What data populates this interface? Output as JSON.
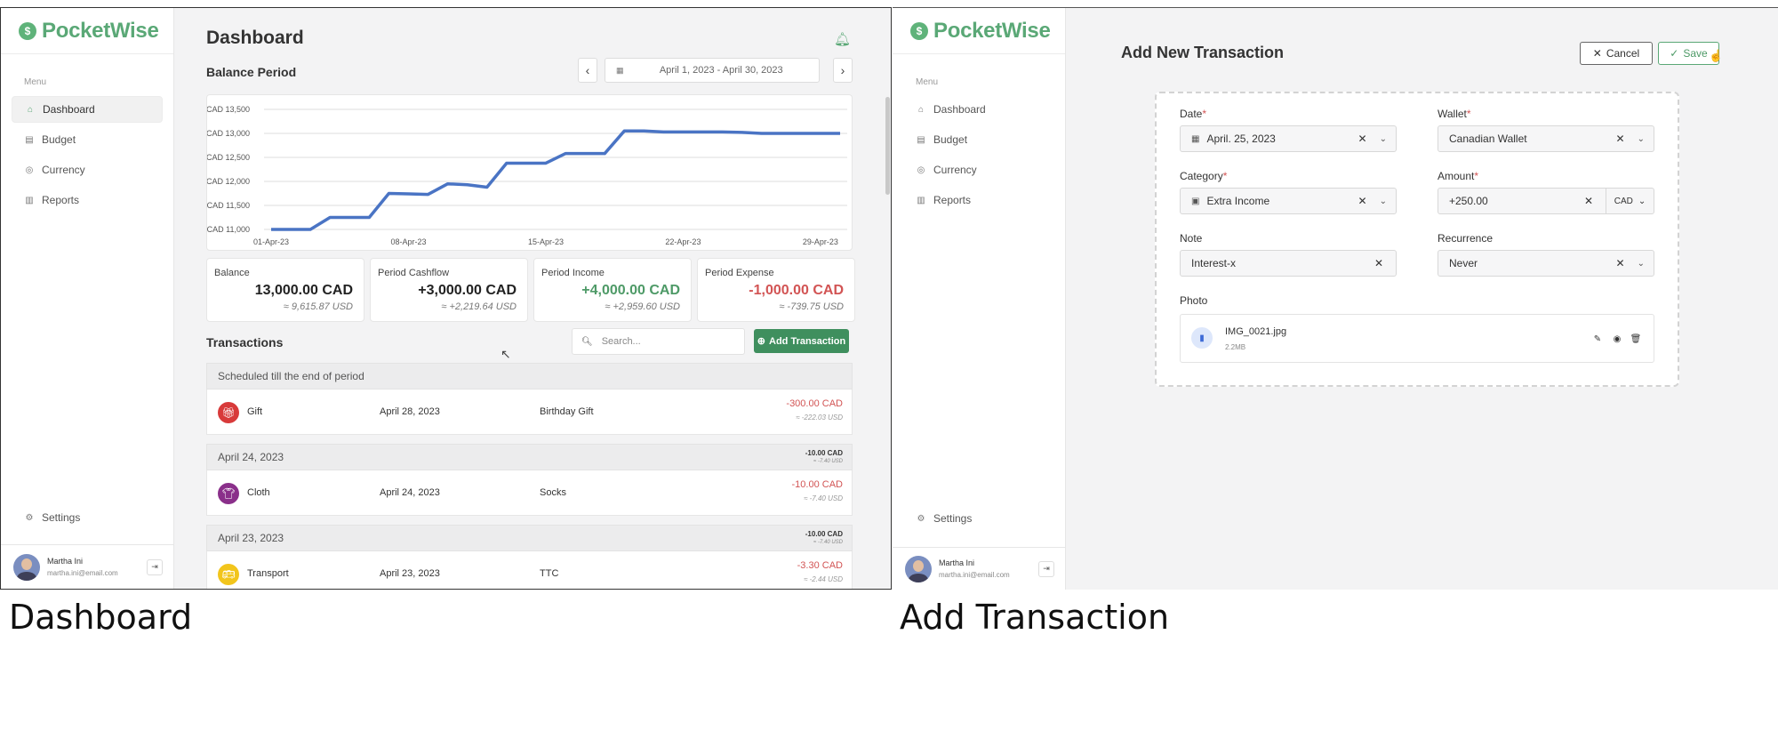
{
  "app_name": "PocketWise",
  "sidebar": {
    "menu_label": "Menu",
    "items": [
      {
        "label": "Dashboard",
        "icon": "home-icon"
      },
      {
        "label": "Budget",
        "icon": "budget-icon"
      },
      {
        "label": "Currency",
        "icon": "currency-icon"
      },
      {
        "label": "Reports",
        "icon": "reports-icon"
      }
    ],
    "settings_label": "Settings",
    "user": {
      "name": "Martha Ini",
      "email": "martha.ini@email.com"
    }
  },
  "dashboard": {
    "title": "Dashboard",
    "balance_period_title": "Balance Period",
    "date_range": "April 1, 2023 - April 30, 2023",
    "cards": [
      {
        "label": "Balance",
        "value": "13,000.00 CAD",
        "sub": "≈ 9,615.87 USD",
        "tone": "neutral"
      },
      {
        "label": "Period Cashflow",
        "value": "+3,000.00 CAD",
        "sub": "≈ +2,219.64 USD",
        "tone": "neutral"
      },
      {
        "label": "Period Income",
        "value": "+4,000.00 CAD",
        "sub": "≈ +2,959.60 USD",
        "tone": "green"
      },
      {
        "label": "Period Expense",
        "value": "-1,000.00 CAD",
        "sub": "≈ -739.75 USD",
        "tone": "red"
      }
    ],
    "transactions_title": "Transactions",
    "search_placeholder": "Search...",
    "add_transaction_label": "Add Transaction",
    "groups": [
      {
        "header": "Scheduled till the end of period",
        "total": "",
        "total_usd": "",
        "rows": [
          {
            "category": "Gift",
            "date": "April 28, 2023",
            "note": "Birthday Gift",
            "amount": "-300.00 CAD",
            "amount_usd": "≈ -222.03 USD",
            "color": "#d83a3a",
            "icon": "gift-icon"
          }
        ]
      },
      {
        "header": "April 24, 2023",
        "total": "-10.00 CAD",
        "total_usd": "≈ -7.40 USD",
        "rows": [
          {
            "category": "Cloth",
            "date": "April 24, 2023",
            "note": "Socks",
            "amount": "-10.00 CAD",
            "amount_usd": "≈ -7.40 USD",
            "color": "#8a2f8a",
            "icon": "shirt-icon"
          }
        ]
      },
      {
        "header": "April 23, 2023",
        "total": "-10.00 CAD",
        "total_usd": "≈ -7.40 USD",
        "rows": [
          {
            "category": "Transport",
            "date": "April 23, 2023",
            "note": "TTC",
            "amount": "-3.30 CAD",
            "amount_usd": "≈ -2.44 USD",
            "color": "#f2c51c",
            "icon": "bus-icon"
          }
        ]
      }
    ]
  },
  "chart_data": {
    "type": "line",
    "x": [
      "01-Apr-23",
      "02-Apr-23",
      "03-Apr-23",
      "04-Apr-23",
      "05-Apr-23",
      "06-Apr-23",
      "07-Apr-23",
      "08-Apr-23",
      "09-Apr-23",
      "10-Apr-23",
      "11-Apr-23",
      "12-Apr-23",
      "13-Apr-23",
      "14-Apr-23",
      "15-Apr-23",
      "16-Apr-23",
      "17-Apr-23",
      "18-Apr-23",
      "19-Apr-23",
      "20-Apr-23",
      "21-Apr-23",
      "22-Apr-23",
      "23-Apr-23",
      "24-Apr-23",
      "25-Apr-23",
      "26-Apr-23",
      "27-Apr-23",
      "28-Apr-23",
      "29-Apr-23",
      "30-Apr-23"
    ],
    "series": [
      {
        "values": [
          11000,
          11000,
          11000,
          11250,
          11250,
          11250,
          11750,
          11740,
          11730,
          11950,
          11930,
          11880,
          12380,
          12380,
          12380,
          12580,
          12580,
          12580,
          13050,
          13050,
          13030,
          13030,
          13030,
          13030,
          13020,
          13000,
          13000,
          13000,
          13000,
          13000
        ]
      }
    ],
    "x_ticks": [
      "01-Apr-23",
      "08-Apr-23",
      "15-Apr-23",
      "22-Apr-23",
      "29-Apr-23"
    ],
    "y_ticks": [
      "CAD 11,000",
      "CAD 11,500",
      "CAD 12,000",
      "CAD 12,500",
      "CAD 13,000",
      "CAD 13,500"
    ],
    "ylim": [
      11000,
      13500
    ],
    "grid": true,
    "line_color": "#4a74c4"
  },
  "add_form": {
    "title": "Add New Transaction",
    "cancel_label": "Cancel",
    "save_label": "Save",
    "date_label": "Date",
    "date_value": "April. 25, 2023",
    "wallet_label": "Wallet",
    "wallet_value": "Canadian Wallet",
    "category_label": "Category",
    "category_value": "Extra Income",
    "amount_label": "Amount",
    "amount_value": "+250.00",
    "currency_value": "CAD",
    "note_label": "Note",
    "note_value": "Interest-x",
    "recurrence_label": "Recurrence",
    "recurrence_value": "Never",
    "photo_label": "Photo",
    "photo_name": "IMG_0021.jpg",
    "photo_size": "2.2MB",
    "required_mark": "*"
  },
  "captions": {
    "left": "Dashboard",
    "right": "Add Transaction"
  },
  "colors": {
    "brand": "#5aa876",
    "button_green": "#3f8f5e",
    "expense": "#d25454",
    "income": "#4e9a67"
  }
}
